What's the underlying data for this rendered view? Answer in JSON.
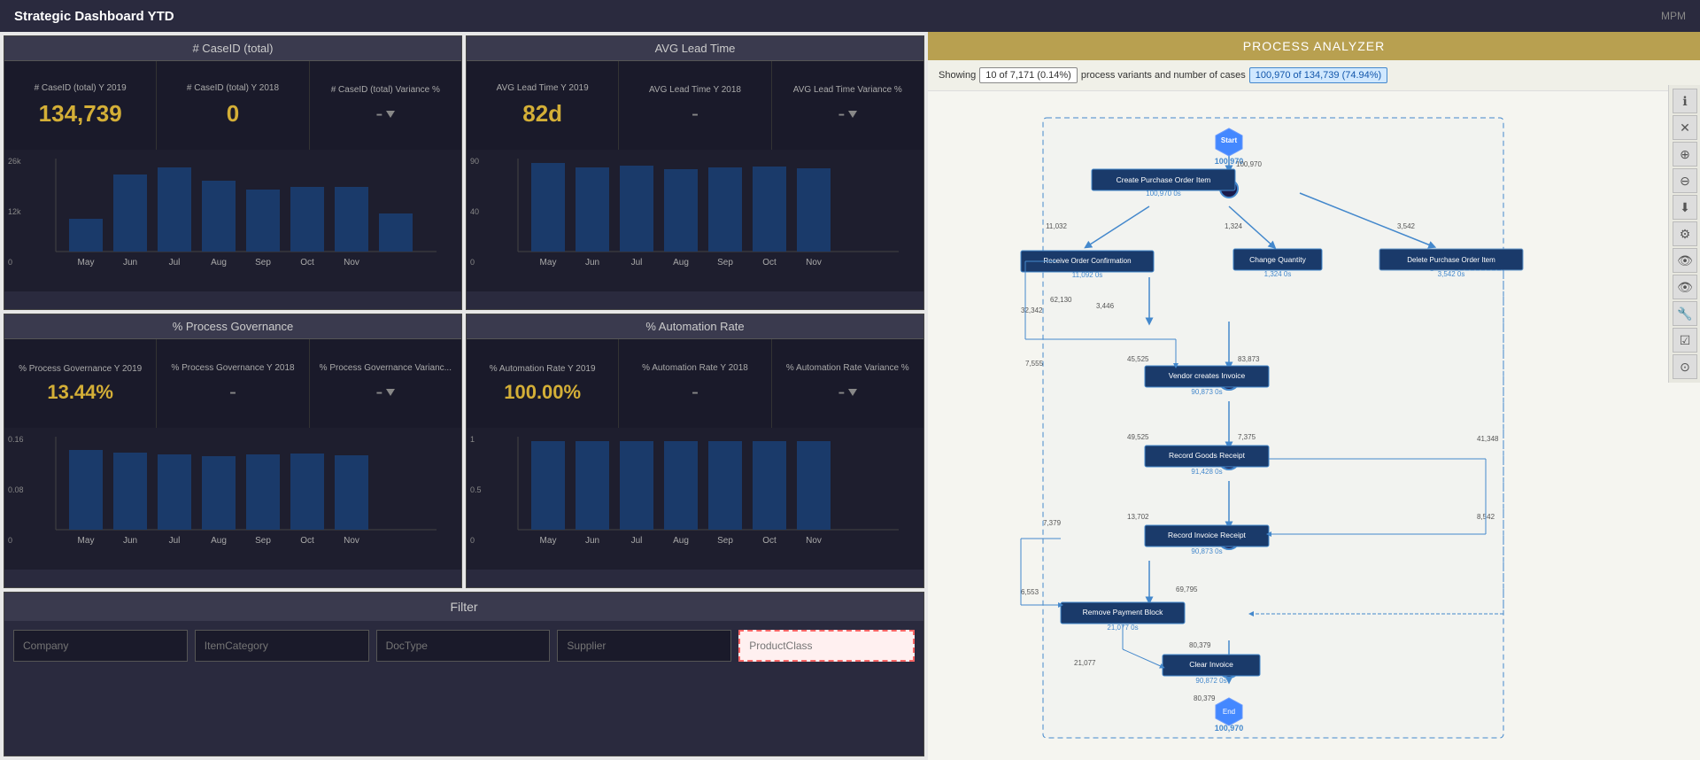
{
  "app": {
    "title": "Strategic Dashboard YTD",
    "logo": "MPM"
  },
  "caseid_section": {
    "header": "# CaseID (total)",
    "kpi1_label": "# CaseID (total) Y 2019",
    "kpi1_value": "134,739",
    "kpi2_label": "# CaseID (total) Y 2018",
    "kpi2_value": "0",
    "kpi3_label": "# CaseID (total) Variance %",
    "kpi3_value": "-",
    "chart_max": "26k",
    "chart_mid": "12k",
    "chart_zero": "0",
    "months": [
      "May",
      "Jun",
      "Jul",
      "Aug",
      "Sep",
      "Oct",
      "Nov"
    ]
  },
  "avg_lead_section": {
    "header": "AVG Lead Time",
    "kpi1_label": "AVG Lead Time Y 2019",
    "kpi1_value": "82d",
    "kpi2_label": "AVG Lead Time Y 2018",
    "kpi2_value": "-",
    "kpi3_label": "AVG Lead Time Variance %",
    "kpi3_value": "-",
    "chart_max": "90",
    "chart_mid": "40",
    "chart_zero": "0"
  },
  "process_gov_section": {
    "header": "% Process Governance",
    "kpi1_label": "% Process Governance Y 2019",
    "kpi1_value": "13.44%",
    "kpi2_label": "% Process Governance Y 2018",
    "kpi2_value": "-",
    "kpi3_label": "% Process Governance Varianc...",
    "kpi3_value": "-",
    "chart_max": "0.16",
    "chart_mid": "0.08",
    "chart_zero": "0"
  },
  "automation_section": {
    "header": "% Automation Rate",
    "kpi1_label": "% Automation Rate Y 2019",
    "kpi1_value": "100.00%",
    "kpi2_label": "% Automation Rate Y 2018",
    "kpi2_value": "-",
    "kpi3_label": "% Automation Rate Variance %",
    "kpi3_value": "-",
    "chart_max": "1",
    "chart_mid": "0.5",
    "chart_zero": "0"
  },
  "filter_section": {
    "header": "Filter",
    "fields": [
      {
        "placeholder": "Company",
        "highlighted": false
      },
      {
        "placeholder": "ItemCategory",
        "highlighted": false
      },
      {
        "placeholder": "DocType",
        "highlighted": false
      },
      {
        "placeholder": "Supplier",
        "highlighted": false
      },
      {
        "placeholder": "ProductClass",
        "highlighted": true
      }
    ]
  },
  "analyzer": {
    "header": "PROCESS ANALYZER",
    "showing_text": "Showing",
    "variants_badge": "10 of 7,171 (0.14%)",
    "variants_text": "process variants and number of cases",
    "cases_badge": "100,970 of 134,739 (74.94%)",
    "nodes": {
      "start_count": "100,970",
      "create_po": "Create Purchase Order Item",
      "create_po_count": "100,970",
      "create_po_time": "0s",
      "receive_order": "Receive Order Confirmation",
      "receive_order_count": "11,092",
      "receive_order_time": "0s",
      "change_qty": "Change Quantity",
      "change_qty_count": "1,324",
      "change_qty_time": "0s",
      "delete_po": "Delete Purchase Order Item",
      "delete_po_count": "3,542",
      "delete_po_time": "0s",
      "vendor_invoice": "Vendor creates Invoice",
      "vendor_invoice_count": "90,873",
      "vendor_invoice_time": "0s",
      "record_goods": "Record Goods Receipt",
      "record_goods_count": "91,428",
      "record_goods_time": "0s",
      "record_invoice": "Record Invoice Receipt",
      "record_invoice_count": "90,873",
      "record_invoice_time": "0s",
      "remove_payment": "Remove Payment Block",
      "remove_payment_count": "21,077",
      "remove_payment_time": "0s",
      "clear_invoice": "Clear Invoice",
      "clear_invoice_count": "90,872",
      "clear_invoice_time": "0s",
      "end_count": "100,970"
    },
    "flow_numbers": {
      "n1": "100,970",
      "n2": "11,032",
      "n3": "1,324",
      "n4": "3,542",
      "n5": "62,130",
      "n6": "32,342",
      "n7": "3,446",
      "n8": "7,555",
      "n9": "45,525",
      "n10": "83,873",
      "n11": "49,525",
      "n12": "7,375",
      "n13": "7,379",
      "n14": "13,702",
      "n15": "6,553",
      "n16": "69,795",
      "n17": "21,077",
      "n18": "80,379",
      "n19": "41,348",
      "n20": "8,542"
    },
    "toolbar": [
      "ℹ",
      "✕",
      "⊕",
      "⊖",
      "⬇",
      "⚙",
      "👁",
      "👁",
      "🔧",
      "☑",
      "⊙"
    ]
  }
}
